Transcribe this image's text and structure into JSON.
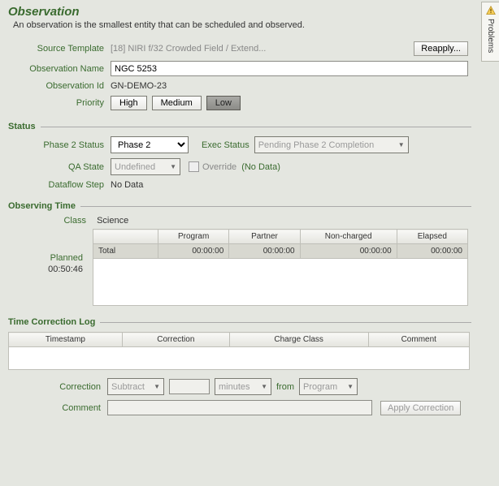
{
  "title": "Observation",
  "subtitle": "An observation is the smallest entity that can be scheduled and observed.",
  "problems_tab": "Problems",
  "source_template": {
    "label": "Source Template",
    "value": "[18] NIRI f/32 Crowded Field / Extend...",
    "reapply": "Reapply..."
  },
  "observation": {
    "name_label": "Observation Name",
    "name_value": "NGC 5253",
    "id_label": "Observation Id",
    "id_value": "GN-DEMO-23",
    "priority_label": "Priority",
    "priority_options": {
      "high": "High",
      "medium": "Medium",
      "low": "Low"
    },
    "priority_selected": "low"
  },
  "status": {
    "section": "Status",
    "phase2_label": "Phase 2 Status",
    "phase2_value": "Phase 2",
    "exec_label": "Exec Status",
    "exec_value": "Pending Phase 2 Completion",
    "qa_label": "QA State",
    "qa_value": "Undefined",
    "override_label": "Override",
    "override_extra": "(No Data)",
    "dataflow_label": "Dataflow Step",
    "dataflow_value": "No Data"
  },
  "observing_time": {
    "section": "Observing Time",
    "class_label": "Class",
    "class_value": "Science",
    "planned_label": "Planned",
    "planned_value": "00:50:46",
    "columns": {
      "blank": "",
      "program": "Program",
      "partner": "Partner",
      "noncharged": "Non-charged",
      "elapsed": "Elapsed"
    },
    "row": {
      "label": "Total",
      "program": "00:00:00",
      "partner": "00:00:00",
      "noncharged": "00:00:00",
      "elapsed": "00:00:00"
    }
  },
  "tcl": {
    "section": "Time Correction Log",
    "columns": {
      "timestamp": "Timestamp",
      "correction": "Correction",
      "charge_class": "Charge Class",
      "comment": "Comment"
    },
    "correction_label": "Correction",
    "op_value": "Subtract",
    "unit_value": "minutes",
    "from_label": "from",
    "class_value": "Program",
    "comment_label": "Comment",
    "apply_label": "Apply Correction"
  }
}
